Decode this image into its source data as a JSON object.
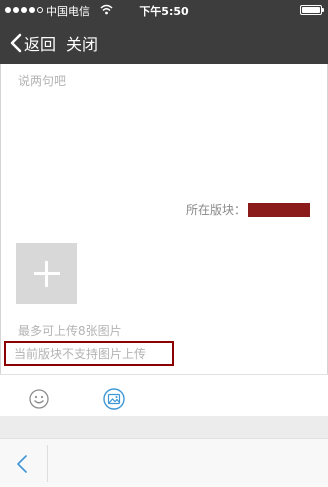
{
  "status_bar": {
    "carrier": "中国电信",
    "time": "下午5:50"
  },
  "nav": {
    "back_label": "返回",
    "close_label": "关闭"
  },
  "composer": {
    "placeholder": "说两句吧",
    "forum_label": "所在版块：",
    "forum_value_color": "#8b1a1a"
  },
  "upload": {
    "max_hint": "最多可上传8张图片",
    "unsupported_text": "当前版块不支持图片上传",
    "highlight_color": "#8b0000"
  },
  "toolbar": {
    "emoji_icon": "smiley-face-icon",
    "image_icon": "image-upload-icon",
    "accent_color": "#3f97d6"
  },
  "bottom_bar": {
    "back_icon": "chevron-left-icon"
  }
}
